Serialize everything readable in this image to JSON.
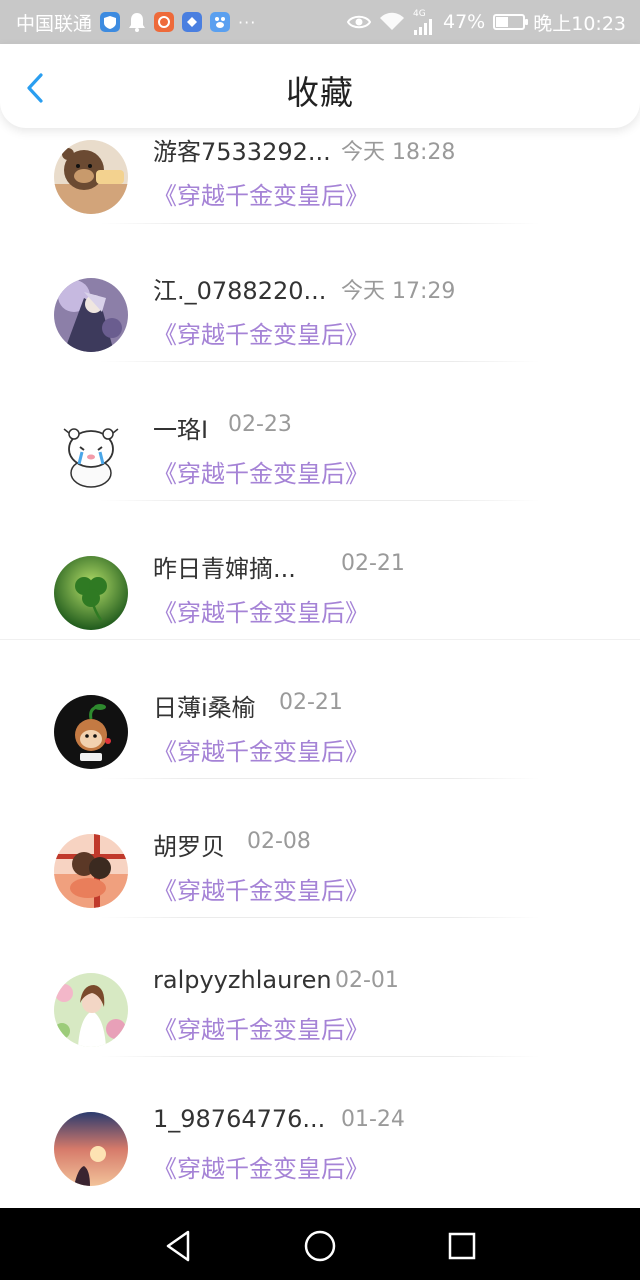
{
  "status_bar": {
    "carrier": "中国联通",
    "network_badge": "4G",
    "battery_percent": "47%",
    "battery_level": 0.47,
    "time": "晚上10:23",
    "more": "···",
    "icons": [
      "shield-app-icon",
      "bell-app-icon",
      "app-icon-orange",
      "app-icon-blue",
      "paw-app-icon",
      "eye-icon",
      "wifi-icon",
      "signal-icon",
      "battery-icon"
    ]
  },
  "header": {
    "title": "收藏",
    "back_icon": "chevron-left-icon",
    "accent": "#2a9ef0"
  },
  "favorites": [
    {
      "name": "游客7533292...",
      "time": "今天 18:28",
      "book": "《穿越千金变皇后》",
      "avatar": "bear-avatar"
    },
    {
      "name": "江._0788220...",
      "time": "今天 17:29",
      "book": "《穿越千金变皇后》",
      "avatar": "anime-avatar"
    },
    {
      "name": "一珞I",
      "time": "02-23",
      "book": "《穿越千金变皇后》",
      "avatar": "crying-bear-avatar"
    },
    {
      "name": "昨日青婶摘...",
      "time": "02-21",
      "book": "《穿越千金变皇后》",
      "avatar": "clover-avatar"
    },
    {
      "name": "日薄i桑榆",
      "time": "02-21",
      "book": "《穿越千金变皇后》",
      "avatar": "monkey-avatar"
    },
    {
      "name": "胡罗贝",
      "time": "02-08",
      "book": "《穿越千金变皇后》",
      "avatar": "couple-avatar"
    },
    {
      "name": "ralpyyzhlauren",
      "time": "02-01",
      "book": "《穿越千金变皇后》",
      "avatar": "girl-flowers-avatar"
    },
    {
      "name": "1_98764776...",
      "time": "01-24",
      "book": "《穿越千金变皇后》",
      "avatar": "sunset-avatar"
    }
  ],
  "nav_bar": {
    "icons": [
      "back-triangle-icon",
      "home-circle-icon",
      "recents-square-icon"
    ]
  },
  "colors": {
    "book_title": "#a583d6",
    "time": "#9a9a9a",
    "name": "#333333"
  }
}
